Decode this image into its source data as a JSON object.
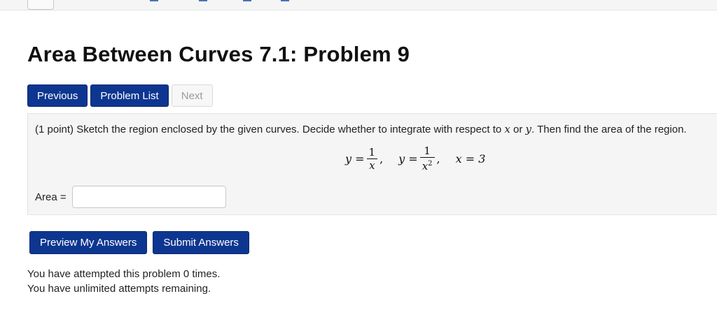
{
  "page": {
    "title": "Area Between Curves 7.1: Problem 9"
  },
  "nav": {
    "previous_label": "Previous",
    "problem_list_label": "Problem List",
    "next_label": "Next"
  },
  "problem": {
    "points": "(1 point)",
    "statement_a": "Sketch the region enclosed by the given curves. Decide whether to integrate with respect to",
    "var_x": "x",
    "statement_or": "or",
    "var_y": "y",
    "statement_b": ". Then find the area of the region.",
    "equation": {
      "lhs1": "y =",
      "frac1_num": "1",
      "frac1_den": "x",
      "lhs2": "y =",
      "frac2_num": "1",
      "frac2_den": "x",
      "frac2_exp": "2",
      "eq3": "x = 3"
    },
    "answer_label": "Area =",
    "answer_value": ""
  },
  "actions": {
    "preview_label": "Preview My Answers",
    "submit_label": "Submit Answers"
  },
  "status": {
    "attempts_line": "You have attempted this problem 0 times.",
    "remaining_line": "You have unlimited attempts remaining."
  },
  "colors": {
    "primary_button": "#0d3690",
    "disabled_button": "#f7f7f7",
    "problem_background": "#f5f5f5"
  }
}
